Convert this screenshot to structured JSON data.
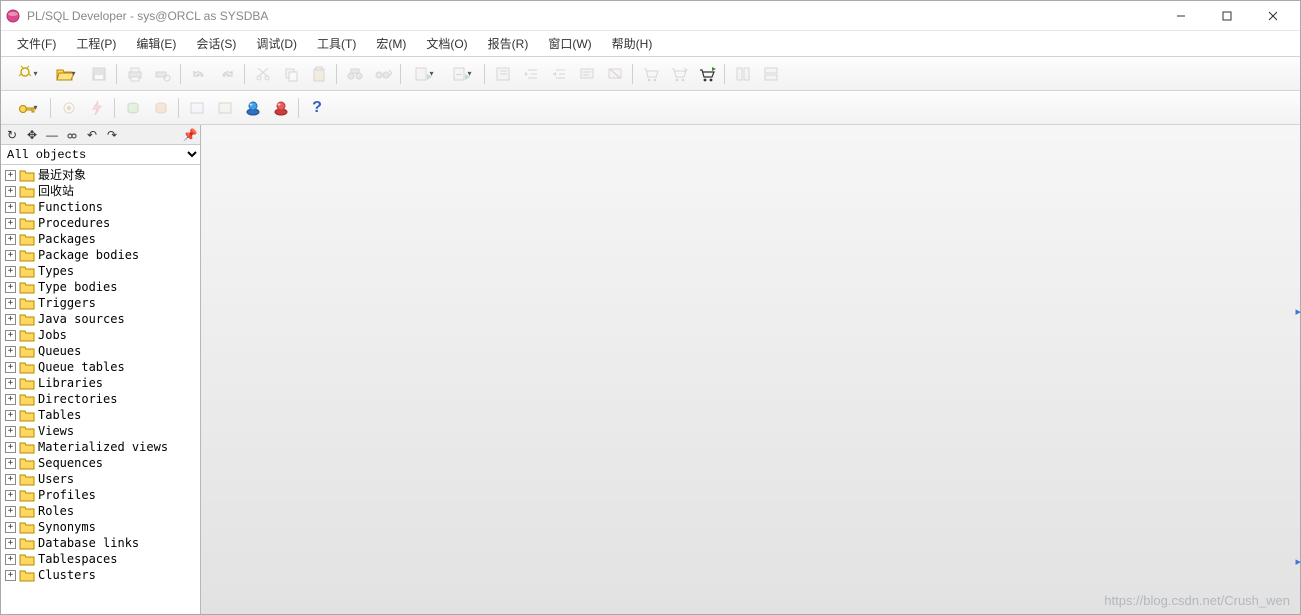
{
  "title": "PL/SQL Developer - sys@ORCL as SYSDBA",
  "menu": {
    "items": [
      "文件(F)",
      "工程(P)",
      "编辑(E)",
      "会话(S)",
      "调试(D)",
      "工具(T)",
      "宏(M)",
      "文档(O)",
      "报告(R)",
      "窗口(W)",
      "帮助(H)"
    ]
  },
  "filter": {
    "selected": "All objects"
  },
  "tree": {
    "nodes": [
      {
        "label": "最近对象"
      },
      {
        "label": "回收站"
      },
      {
        "label": "Functions"
      },
      {
        "label": "Procedures"
      },
      {
        "label": "Packages"
      },
      {
        "label": "Package bodies"
      },
      {
        "label": "Types"
      },
      {
        "label": "Type bodies"
      },
      {
        "label": "Triggers"
      },
      {
        "label": "Java sources"
      },
      {
        "label": "Jobs"
      },
      {
        "label": "Queues"
      },
      {
        "label": "Queue tables"
      },
      {
        "label": "Libraries"
      },
      {
        "label": "Directories"
      },
      {
        "label": "Tables"
      },
      {
        "label": "Views"
      },
      {
        "label": "Materialized views"
      },
      {
        "label": "Sequences"
      },
      {
        "label": "Users"
      },
      {
        "label": "Profiles"
      },
      {
        "label": "Roles"
      },
      {
        "label": "Synonyms"
      },
      {
        "label": "Database links"
      },
      {
        "label": "Tablespaces"
      },
      {
        "label": "Clusters"
      }
    ]
  },
  "watermark": "https://blog.csdn.net/Crush_wen"
}
